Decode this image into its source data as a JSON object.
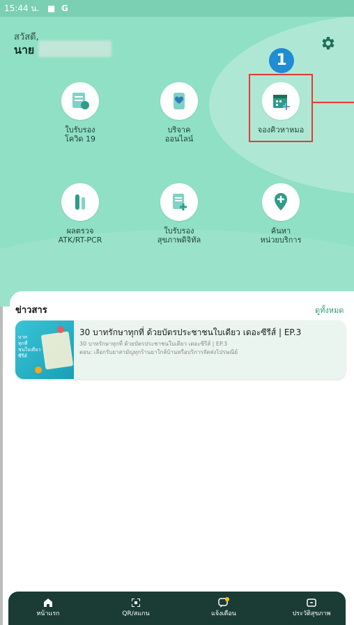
{
  "status": {
    "time": "15:44 น.",
    "icons": [
      "■",
      "G"
    ]
  },
  "header": {
    "greeting": "สวัสดี,",
    "user_prefix": "นาย"
  },
  "menu": [
    {
      "label": "ใบรับรอง\nโควิด 19"
    },
    {
      "label": "บริจาค\nออนไลน์"
    },
    {
      "label": "จองคิวหาหมอ"
    },
    {
      "label": "ผลตรวจ\nATK/RT-PCR"
    },
    {
      "label": "ใบรับรอง\nสุขภาพดิจิทัล"
    },
    {
      "label": "ค้นหา\nหน่วยบริการ"
    }
  ],
  "annotation": {
    "step": "1"
  },
  "news": {
    "title": "ข่าวสาร",
    "see_all": "ดูทั้งหมด",
    "items": [
      {
        "headline": "30 บาทรักษาทุกที่ ด้วยบัตรประชาชนใบเดียว เดอะซีรีส์ | EP.3",
        "subtitle": "30 บาทรักษาทุกที่ ด้วยบัตรประชาชนใบเดียว เดอะซีรีส์ | EP.3",
        "desc": "ตอน: เลือกรับยาสามัญทุกร้านยาใกล้บ้านหรือบริการจัดส่งไปรษณีย์",
        "thumb_text": "บาท\nทุกที่\nชนใบเดียว\nซีรีส์"
      }
    ]
  },
  "nav": [
    {
      "label": "หน้าแรก"
    },
    {
      "label": "QR/สแกน"
    },
    {
      "label": "แจ้งเตือน"
    },
    {
      "label": "ประวัติสุขภาพ"
    }
  ],
  "colors": {
    "hero": "#8fe0c4",
    "accent": "#2f9b75",
    "nav_bg": "#1b3b35",
    "highlight": "#e53935",
    "badge": "#1f8cd3"
  }
}
